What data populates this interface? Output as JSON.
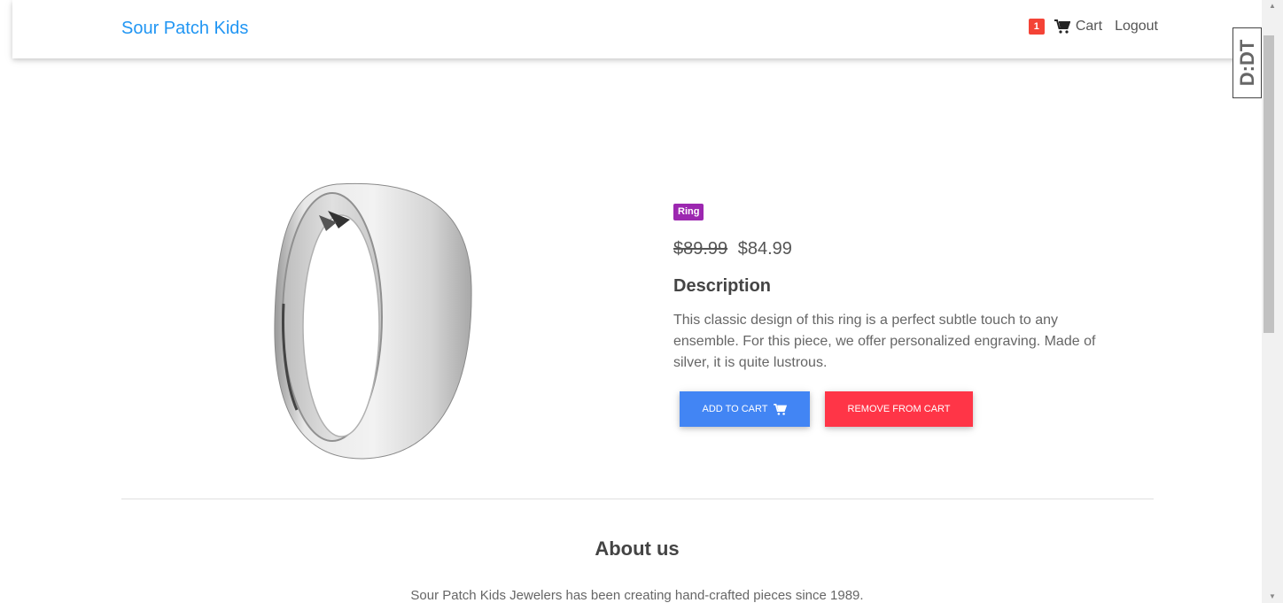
{
  "navbar": {
    "brand": "Sour Patch Kids",
    "cart_count": "1",
    "cart_label": "Cart",
    "logout_label": "Logout"
  },
  "extension_badge": "D:DT",
  "product": {
    "category": "Ring",
    "old_price": "$89.99",
    "price": "$84.99",
    "description_title": "Description",
    "description": "This classic design of this ring is a perfect subtle touch to any ensemble. For this piece, we offer personalized engraving. Made of silver, it is quite lustrous.",
    "add_to_cart_label": "ADD TO CART",
    "remove_from_cart_label": "REMOVE FROM CART",
    "image_icon": "silver-ring-image"
  },
  "about": {
    "title": "About us",
    "text": "Sour Patch Kids Jewelers has been creating hand-crafted pieces since 1989."
  },
  "colors": {
    "brand": "#2196f3",
    "primary_button": "#4285f4",
    "danger_button": "#ff3547",
    "category_badge": "#9c27b0",
    "cart_badge": "#f44336"
  }
}
